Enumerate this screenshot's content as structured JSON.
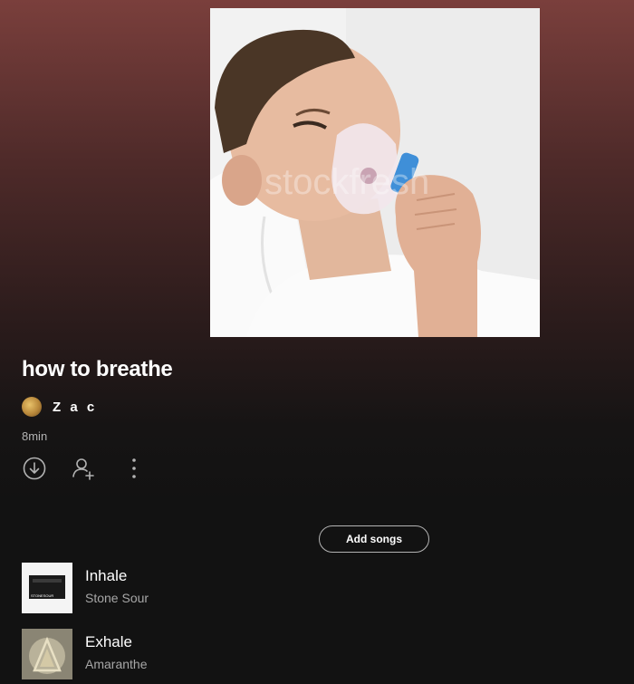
{
  "playlist": {
    "title": "how to breathe",
    "owner": "Z a c",
    "duration": "8min",
    "cover_watermark": "stockfresh"
  },
  "actions": {
    "download_icon": "download-icon",
    "add_user_icon": "add-user-icon",
    "more_icon": "more-vertical-icon"
  },
  "add_songs_label": "Add songs",
  "tracks": [
    {
      "title": "Inhale",
      "artist": "Stone Sour",
      "art_caption": "STONESOUR"
    },
    {
      "title": "Exhale",
      "artist": "Amaranthe"
    }
  ],
  "colors": {
    "gradient_top": "#7a3f3c",
    "background": "#121212",
    "secondary_text": "#b3b3b3"
  }
}
